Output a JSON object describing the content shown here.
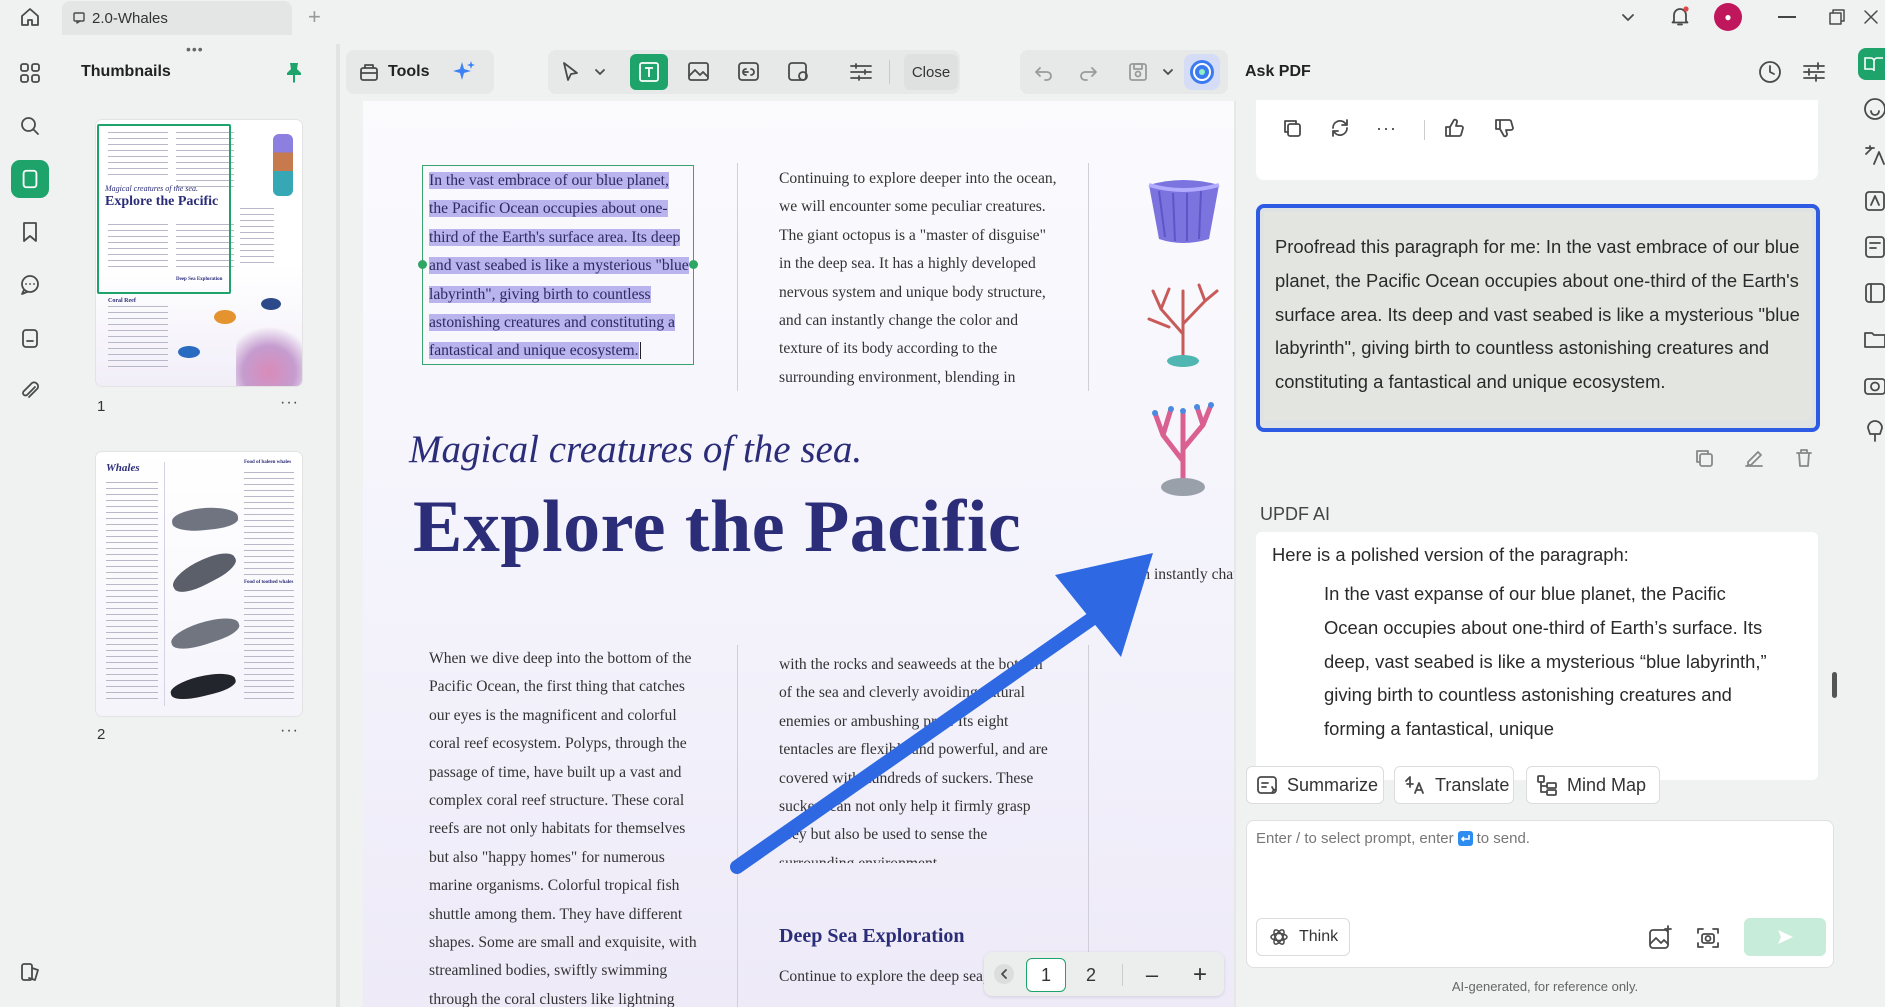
{
  "tab": {
    "title": "2.0-Whales"
  },
  "thumbnails": {
    "title": "Thumbnails",
    "pages": [
      {
        "label": "1"
      },
      {
        "label": "2"
      }
    ],
    "p1": {
      "sub": "Magical creatures of the sea.",
      "title": "Explore the Pacific",
      "head1": "Coral Reef",
      "head2": "Deep Sea Exploration"
    },
    "p2": {
      "title": "Whales",
      "head1": "Food of baleen whales",
      "head2": "Food of toothed whales"
    }
  },
  "toolbar": {
    "tools_label": "Tools",
    "close_label": "Close"
  },
  "doc": {
    "selected_text": "In the vast embrace of our blue planet, the Pacific Ocean occupies about one-third of the Earth's surface area. Its deep and vast seabed is like a mysterious \"blue labyrinth\", giving birth to countless astonishing creatures and constituting a fantastical and unique ecosystem.",
    "col2_top": "Continuing to explore deeper into the ocean, we will encounter some peculiar creatures. The giant octopus is a \"master of disguise\" in the deep sea. It has a highly developed nervous system and unique body structure, and can instantly change the color and texture of its body according to the surrounding environment, blending in",
    "subtitle": "Magical creatures of the sea.",
    "title": "Explore the Pacific",
    "col1_bottom": "When we dive deep into the bottom of the Pacific Ocean, the first thing that catches our eyes is the magnificent and colorful coral reef ecosystem. Polyps, through the passage of time, have built up a vast and complex coral reef structure. These coral reefs are not only habitats for themselves but also \"happy homes\" for numerous marine organisms. Colorful tropical fish shuttle among them. They have different shapes. Some are small and exquisite, with streamlined bodies, swiftly swimming through the coral clusters like lightning",
    "col2_bottom": "with the rocks and seaweeds at the bottom of the sea and cleverly avoiding natural enemies or ambushing prey. Its eight tentacles are flexible and powerful, and are covered with hundreds of suckers. These suckers can not only help it firmly grasp prey but also be used to sense the surrounding environment.",
    "col3_bottom": "It can instantly change the color and texture of its body according to the surrounding environment, blending in with the rocks and seaweeds at the bottom of the sea and cleverly avoiding natural enemies or ambushing prey. Its eight tentacles are flexible and powerful, and are covered with hundreds of suckers. These suckers can not only help it firmly grasp prey but also be used to sense the surrounding environment.",
    "section_heading": "Deep Sea Exploration",
    "section_text": "Continue to explore the deep sea, we will encounter"
  },
  "pager": {
    "page1": "1",
    "page2": "2",
    "minus": "–",
    "plus": "+"
  },
  "ask": {
    "title": "Ask PDF",
    "user_message": "Proofread this paragraph for me: In the vast embrace of our blue planet, the Pacific Ocean occupies about one-third of the Earth's surface area. Its deep and vast seabed is like a mysterious \"blue labyrinth\", giving birth to countless astonishing creatures and constituting a fantastical and unique ecosystem.",
    "ai_name": "UPDF AI",
    "ai_intro": "Here is a polished version of the paragraph:",
    "ai_text": "In the vast expanse of our blue planet, the Pacific Ocean occupies about one-third of Earth’s surface. Its deep, vast seabed is like a mysterious “blue labyrinth,” giving birth to countless astonishing creatures and forming a fantastical, unique",
    "chips": {
      "summarize": "Summarize",
      "translate": "Translate",
      "mindmap": "Mind Map"
    },
    "input_prefix": "Enter / to select prompt, enter",
    "input_suffix": "to send.",
    "think_label": "Think",
    "disclaimer": "AI-generated, for reference only."
  },
  "colors": {
    "accent": "#1ea36b",
    "selection": "#2d5be3",
    "title": "#2b2d78"
  }
}
